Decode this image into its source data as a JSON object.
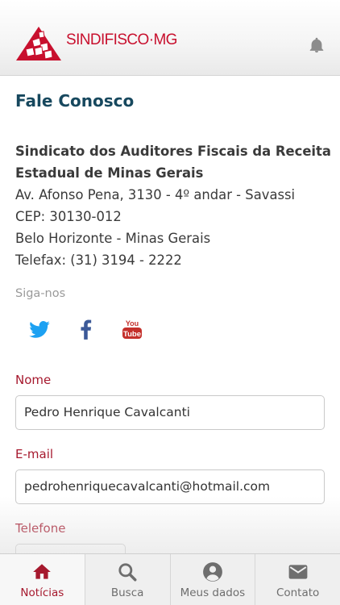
{
  "header": {
    "brand": "SINDIFISCO·MG",
    "logo_icon": "sindifisco-logo",
    "notification_icon": "bell-icon"
  },
  "page": {
    "title": "Fale Conosco"
  },
  "organization": {
    "name_line1": "Sindicato dos Auditores Fiscais da Receita",
    "name_line2": "Estadual de Minas Gerais",
    "address": "Av. Afonso Pena, 3130 - 4º andar - Savassi",
    "cep": "CEP: 30130-012",
    "city": "Belo Horizonte - Minas Gerais",
    "phone": "Telefax: (31) 3194 - 2222"
  },
  "social": {
    "label": "Siga-nos",
    "items": [
      {
        "name": "twitter-icon",
        "color": "#1da1f2"
      },
      {
        "name": "facebook-icon",
        "color": "#3b5998"
      },
      {
        "name": "youtube-icon",
        "color": "#c4302b"
      }
    ]
  },
  "form": {
    "name_label": "Nome",
    "name_value": "Pedro Henrique Cavalcanti",
    "email_label": "E-mail",
    "email_value": "pedrohenriquecavalcanti@hotmail.com",
    "phone_label": "Telefone",
    "phone_value": ""
  },
  "tabs": [
    {
      "label": "Notícias",
      "icon": "home-icon",
      "active": true
    },
    {
      "label": "Busca",
      "icon": "search-icon",
      "active": false
    },
    {
      "label": "Meus dados",
      "icon": "user-icon",
      "active": false
    },
    {
      "label": "Contato",
      "icon": "mail-icon",
      "active": false
    }
  ],
  "colors": {
    "accent": "#a6192e",
    "brand": "#c8102e",
    "title": "#17485e"
  }
}
